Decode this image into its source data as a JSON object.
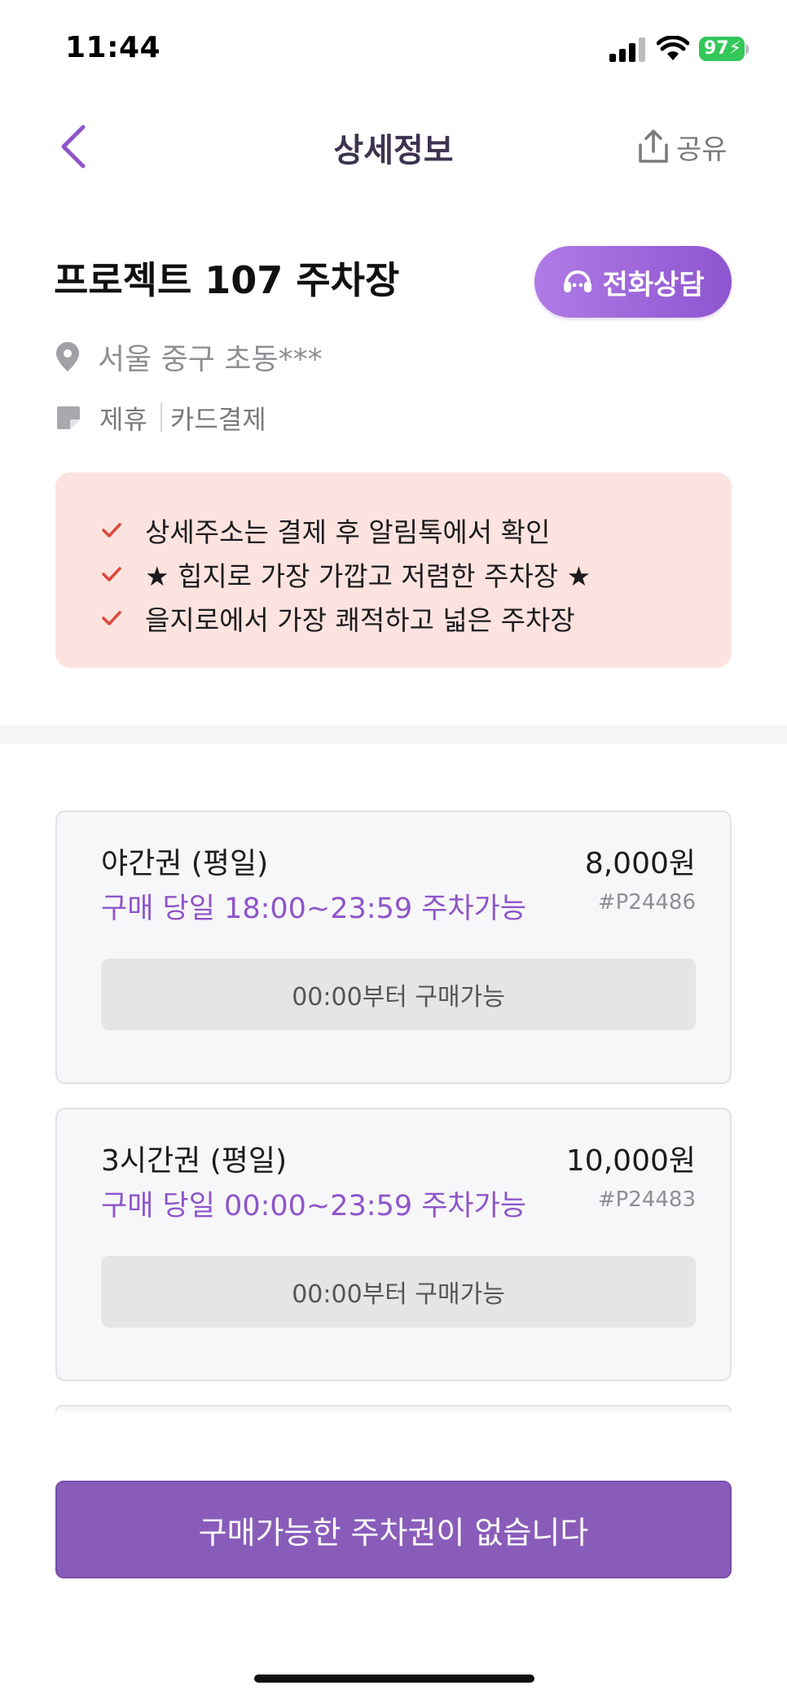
{
  "status_bar": {
    "time": "11:44",
    "battery": "97"
  },
  "nav": {
    "title": "상세정보",
    "share_label": "공유"
  },
  "lot": {
    "title": "프로젝트 107 주차장",
    "consult_label": "전화상담",
    "address": "서울 중구 초동***",
    "tags": [
      "제휴",
      "카드결제"
    ]
  },
  "notice": {
    "items": [
      "상세주소는 결제 후 알림톡에서 확인",
      "★ 힙지로 가장 가깝고 저렴한 주차장 ★",
      "을지로에서 가장 쾌적하고 넓은 주차장"
    ]
  },
  "tickets": [
    {
      "name": "야간권 (평일)",
      "price": "8,000원",
      "hours": "구매 당일 18:00~23:59 주차가능",
      "code": "#P24486",
      "button": "00:00부터 구매가능"
    },
    {
      "name": "3시간권 (평일)",
      "price": "10,000원",
      "hours": "구매 당일 00:00~23:59 주차가능",
      "code": "#P24483",
      "button": "00:00부터 구매가능"
    }
  ],
  "cta": {
    "label": "구매가능한 주차권이 없습니다"
  },
  "colors": {
    "accent": "#8a5cba",
    "notice_bg": "#fce3df",
    "check": "#e0453a"
  },
  "icons": [
    "back-chevron-icon",
    "share-icon",
    "headset-icon",
    "location-pin-icon",
    "tag-icon",
    "check-icon"
  ]
}
